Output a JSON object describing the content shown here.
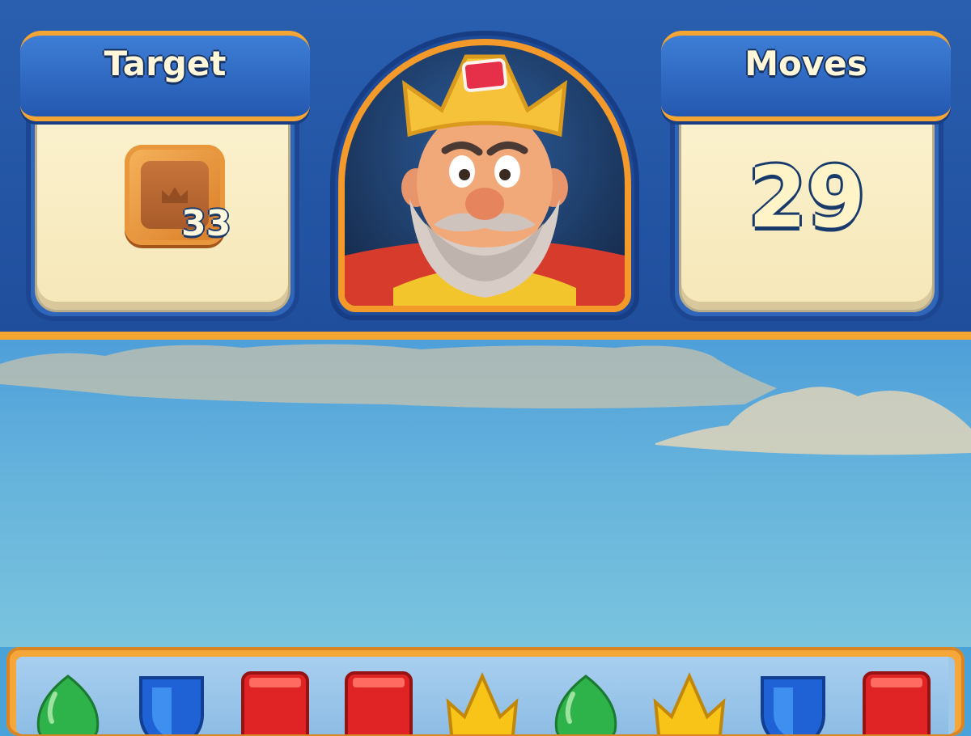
{
  "hud": {
    "target_label": "Target",
    "target_count": "33",
    "moves_label": "Moves",
    "moves_value": "29"
  },
  "colors": {
    "hud_blue": "#2458b0",
    "accent_orange": "#f4a533",
    "panel_cream": "#fbf2cf",
    "sky": "#66b3dc"
  },
  "target_item": "wooden-crown-box-icon",
  "portrait": "king-avatar",
  "board_row": [
    "green-leaf",
    "blue-shield",
    "red-book",
    "red-book",
    "yellow-crown",
    "green-leaf",
    "yellow-crown",
    "blue-shield",
    "red-book"
  ]
}
